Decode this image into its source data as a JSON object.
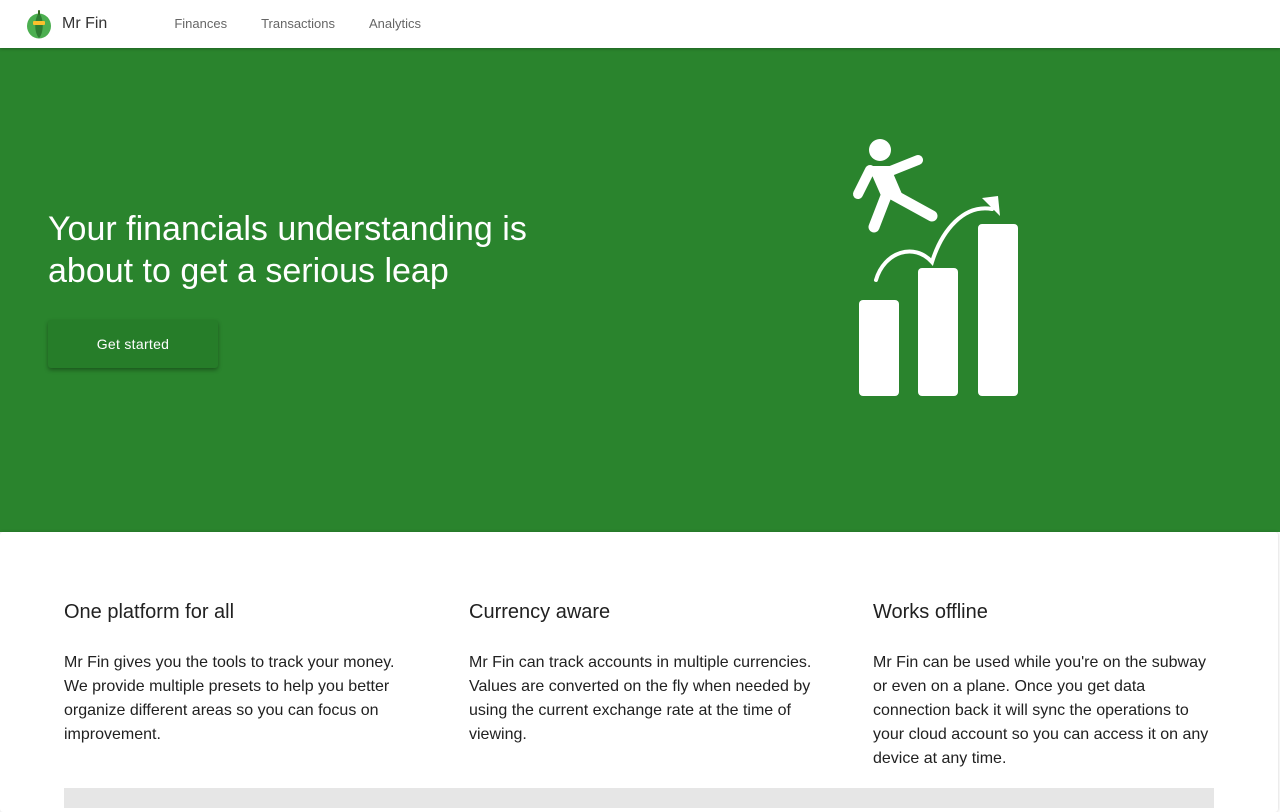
{
  "app": {
    "name": "Mr Fin",
    "logo_icon": "leaf-logo-icon"
  },
  "nav": {
    "items": [
      {
        "label": "Finances"
      },
      {
        "label": "Transactions"
      },
      {
        "label": "Analytics"
      }
    ]
  },
  "hero": {
    "title": "Your financials understanding is about to get a serious leap",
    "cta_label": "Get started",
    "illustration_icon": "person-leaping-over-growth-bars-icon",
    "background_color": "#2a842d"
  },
  "features": [
    {
      "title": "One platform for all",
      "text": "Mr Fin gives you the tools to track your money. We provide multiple presets to help you better organize different areas so you can focus on improvement."
    },
    {
      "title": "Currency aware",
      "text": "Mr Fin can track accounts in multiple currencies. Values are converted on the fly when needed by using the current exchange rate at the time of viewing."
    },
    {
      "title": "Works offline",
      "text": "Mr Fin can be used while you're on the subway or even on a plane. Once you get data connection back it will sync the operations to your cloud account so you can access it on any device at any time."
    }
  ]
}
